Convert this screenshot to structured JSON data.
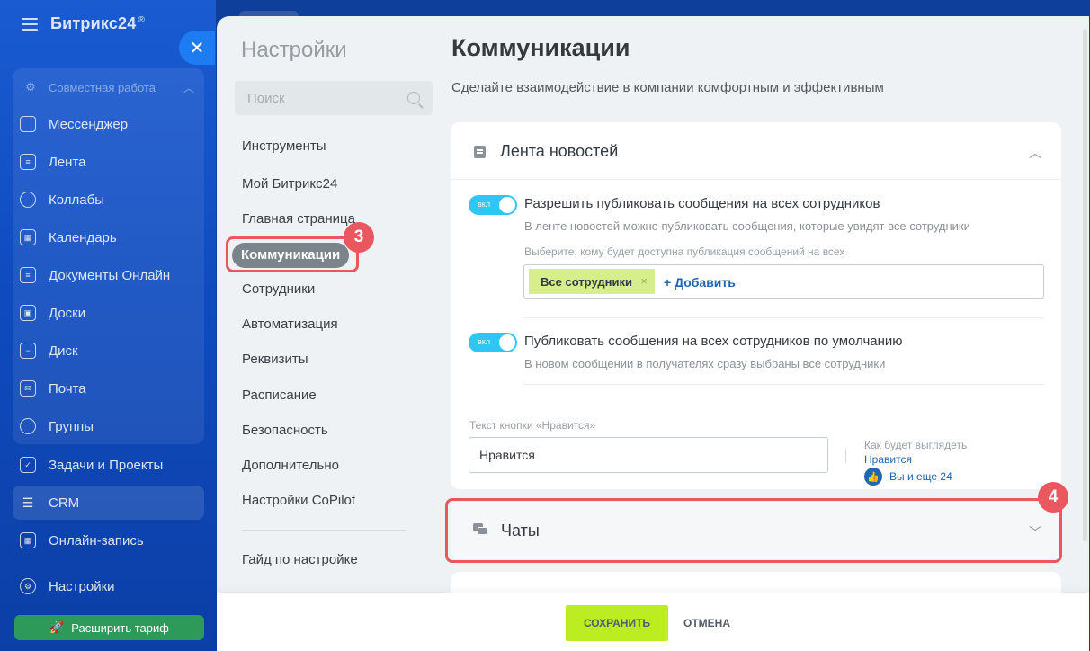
{
  "app": {
    "brand": "Битрикс24",
    "brand_mark": "®",
    "group_label": "Совместная работа",
    "nav": [
      {
        "label": "Мессенджер",
        "icon": "chat-icon"
      },
      {
        "label": "Лента",
        "icon": "feed-icon"
      },
      {
        "label": "Коллабы",
        "icon": "collab-icon"
      },
      {
        "label": "Календарь",
        "icon": "calendar-icon"
      },
      {
        "label": "Документы Онлайн",
        "icon": "document-icon"
      },
      {
        "label": "Доски",
        "icon": "board-icon"
      },
      {
        "label": "Диск",
        "icon": "disk-icon"
      },
      {
        "label": "Почта",
        "icon": "mail-icon"
      },
      {
        "label": "Группы",
        "icon": "groups-icon"
      },
      {
        "label": "Задачи и Проекты",
        "icon": "tasks-icon"
      },
      {
        "label": "CRM",
        "icon": "crm-icon"
      },
      {
        "label": "Онлайн-запись",
        "icon": "booking-icon"
      },
      {
        "label": "Настройки",
        "icon": "gear-icon"
      }
    ],
    "upgrade_label": "Расширить тариф"
  },
  "settings": {
    "title": "Настройки",
    "search_placeholder": "Поиск",
    "menu": [
      "Инструменты",
      "Мой Битрикс24",
      "Главная страница",
      "Коммуникации",
      "Сотрудники",
      "Автоматизация",
      "Реквизиты",
      "Расписание",
      "Безопасность",
      "Дополнительно",
      "Настройки CoPilot",
      "Гайд по настройке"
    ],
    "active_item": "Коммуникации"
  },
  "page": {
    "title": "Коммуникации",
    "subtitle": "Сделайте взаимодействие в компании комфортным и эффективным"
  },
  "feed_section": {
    "title": "Лента новостей",
    "option1": {
      "toggle": "вкл",
      "title": "Разрешить публиковать сообщения на всех сотрудников",
      "desc": "В ленте новостей можно публиковать сообщения, которые увидят все сотрудники",
      "select_label": "Выберите, кому будет доступна публикация сообщений на всех",
      "chip": "Все сотрудники",
      "chip_remove": "×",
      "add": "+ Добавить"
    },
    "option2": {
      "toggle": "вкл",
      "title": "Публиковать сообщения на всех сотрудников по умолчанию",
      "desc": "В новом сообщении в получателях сразу выбраны все сотрудники"
    },
    "like": {
      "label": "Текст кнопки «Нравится»",
      "value": "Нравится",
      "preview_label": "Как будет выглядеть",
      "preview_like": "Нравится",
      "preview_count": "Вы и еще 24"
    }
  },
  "chats_section": {
    "title": "Чаты"
  },
  "badges": {
    "step3": "3",
    "step4": "4"
  },
  "footer": {
    "save": "СОХРАНИТЬ",
    "cancel": "ОТМЕНА"
  },
  "colors": {
    "accent": "#2fc6f6",
    "save": "#bbed21",
    "callout": "#e8585e",
    "sidebar": "#0f4bbf"
  }
}
